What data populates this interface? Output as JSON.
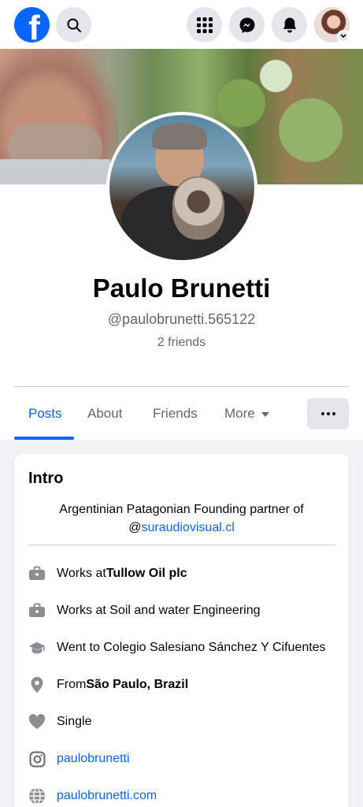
{
  "header": {
    "logo": "facebook-logo",
    "logo_letter": "f",
    "icons": [
      "search-icon",
      "menu-grid-icon",
      "messenger-icon",
      "bell-icon",
      "avatar"
    ]
  },
  "profile": {
    "name": "Paulo Brunetti",
    "username": "@paulobrunetti.565122",
    "friends": "2 friends"
  },
  "tabs": {
    "items": [
      {
        "label": "Posts",
        "active": true
      },
      {
        "label": "About"
      },
      {
        "label": "Friends"
      },
      {
        "label": "More"
      }
    ]
  },
  "intro": {
    "title": "Intro",
    "bio_text": "Argentinian Patagonian Founding partner of",
    "bio_at": "@",
    "bio_link": "suraudiovisual.cl",
    "rows": [
      {
        "icon": "briefcase-icon",
        "prefix": "Works at ",
        "bold": "Tullow Oil plc"
      },
      {
        "icon": "briefcase-icon",
        "prefix": "Works at Soil and water Engineering",
        "bold": ""
      },
      {
        "icon": "graduation-cap-icon",
        "prefix": "Went to Colegio Salesiano Sánchez Y Cifuentes",
        "bold": ""
      },
      {
        "icon": "location-pin-icon",
        "prefix": "From ",
        "bold": "São Paulo, Brazil"
      },
      {
        "icon": "heart-icon",
        "prefix": "Single",
        "bold": ""
      },
      {
        "icon": "instagram-icon",
        "link": "paulobrunetti"
      },
      {
        "icon": "globe-icon",
        "link": "paulobrunetti.com"
      }
    ]
  },
  "colors": {
    "brand_blue": "#0866ff",
    "text_secondary": "#65676b",
    "button_grey": "#e4e6eb",
    "page_grey": "#f0f2f5"
  }
}
